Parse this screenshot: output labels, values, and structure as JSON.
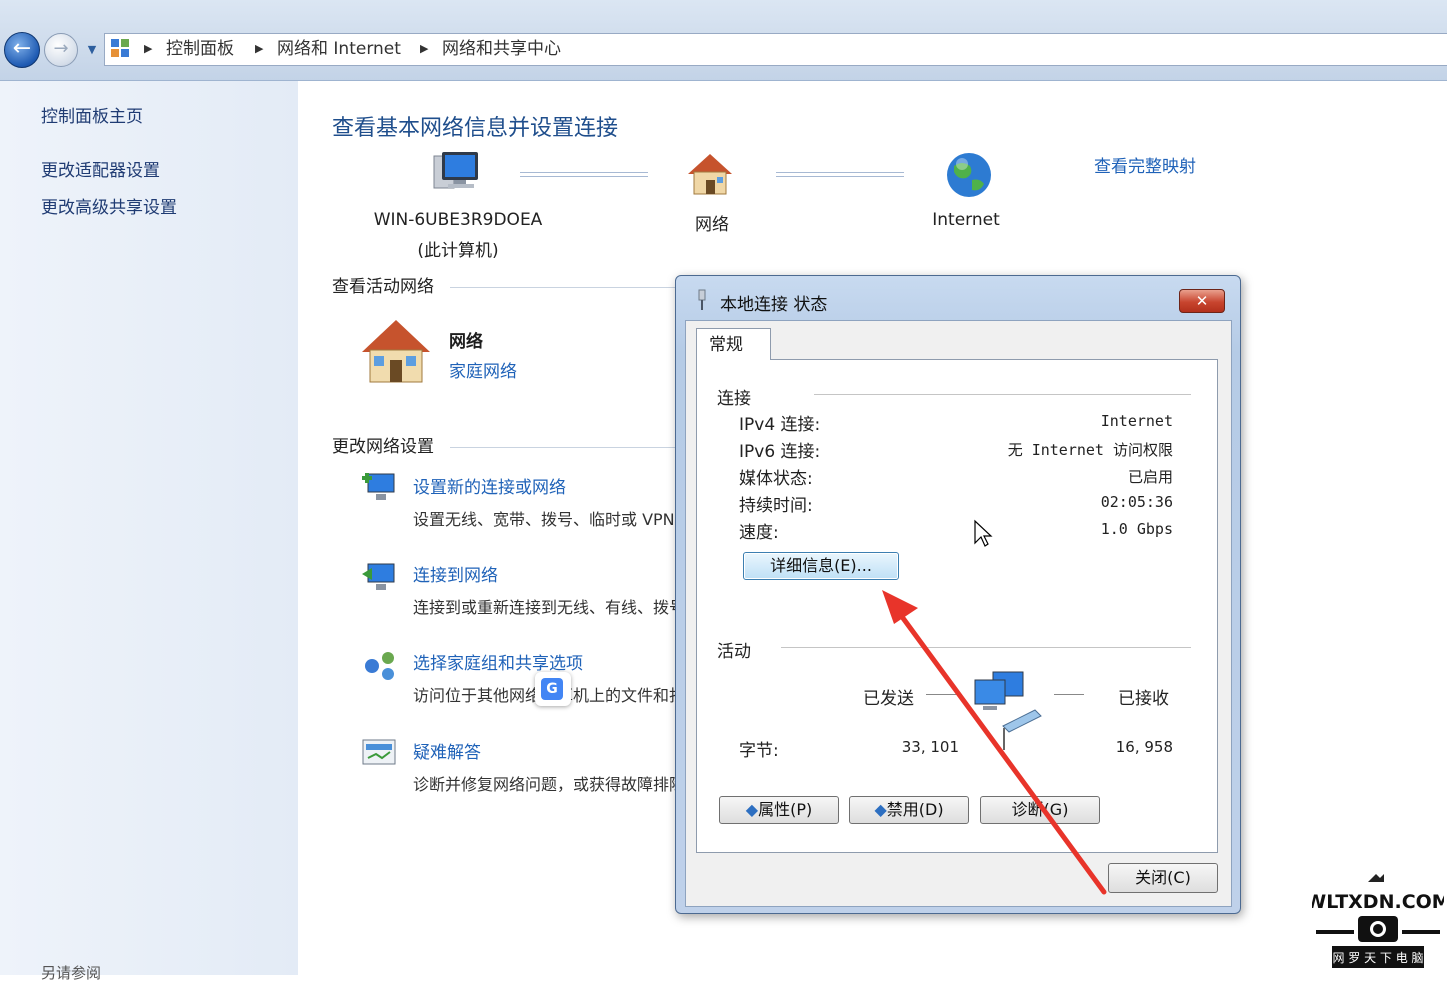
{
  "breadcrumb": [
    "控制面板",
    "网络和 Internet",
    "网络和共享中心"
  ],
  "sidebar": {
    "items": [
      "控制面板主页",
      "更改适配器设置",
      "更改高级共享设置"
    ],
    "see_also": "另请参阅"
  },
  "main": {
    "title": "查看基本网络信息并设置连接",
    "full_map_link": "查看完整映射",
    "map": {
      "computer_name": "WIN-6UBE3R9DOEA",
      "computer_sub": "(此计算机)",
      "network": "网络",
      "internet": "Internet"
    },
    "active_section": "查看活动网络",
    "active_network": {
      "name": "网络",
      "type": "家庭网络"
    },
    "settings_section": "更改网络设置",
    "tasks": [
      {
        "title": "设置新的连接或网络",
        "desc": "设置无线、宽带、拨号、临时或 VPN 连接；或设置路由器或访问点。"
      },
      {
        "title": "连接到网络",
        "desc": "连接到或重新连接到无线、有线、拨号或 VPN 网络连接。"
      },
      {
        "title": "选择家庭组和共享选项",
        "desc": "访问位于其他网络计算机上的文件和打印机，或更改共享设置。"
      },
      {
        "title": "疑难解答",
        "desc": "诊断并修复网络问题，或获得故障排除信息。"
      }
    ]
  },
  "dialog": {
    "title": "本地连接 状态",
    "close_glyph": "✕",
    "tab": "常规",
    "connection_group": "连接",
    "rows": [
      {
        "label": "IPv4 连接:",
        "value": "Internet"
      },
      {
        "label": "IPv6 连接:",
        "value": "无 Internet 访问权限"
      },
      {
        "label": "媒体状态:",
        "value": "已启用"
      },
      {
        "label": "持续时间:",
        "value": "02:05:36"
      },
      {
        "label": "速度:",
        "value": "1.0 Gbps"
      }
    ],
    "details_button": "详细信息(E)...",
    "activity_group": "活动",
    "sent_label": "已发送",
    "received_label": "已接收",
    "bytes_label": "字节:",
    "bytes_sent": "33, 101",
    "bytes_received": "16, 958",
    "properties_button": "属性(P)",
    "disable_button": "禁用(D)",
    "diagnose_button": "诊断(G)",
    "close_button": "关闭(C)"
  },
  "watermark": {
    "brand": "WLTXDN.COM",
    "tagline": "网 罗 天 下 电 脑"
  },
  "colors": {
    "link": "#1f62b8",
    "title": "#1f4e8c",
    "annotation_arrow": "#e8342a"
  }
}
